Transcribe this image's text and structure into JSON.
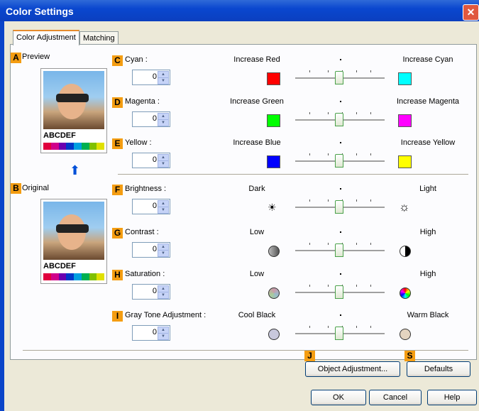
{
  "window": {
    "title": "Color Settings"
  },
  "tabs": [
    {
      "label": "Color Adjustment"
    },
    {
      "label": "Matching"
    }
  ],
  "preview": {
    "badge": "A",
    "label": "Preview",
    "caption": "ABCDEF"
  },
  "original": {
    "badge": "B",
    "label": "Original",
    "caption": "ABCDEF"
  },
  "rows": [
    {
      "badge": "C",
      "label": "Cyan :",
      "value": "0",
      "left": "Increase Red",
      "right": "Increase Cyan",
      "left_color": "#ff0000",
      "right_color": "#00ffff"
    },
    {
      "badge": "D",
      "label": "Magenta :",
      "value": "0",
      "left": "Increase Green",
      "right": "Increase Magenta",
      "left_color": "#00ff00",
      "right_color": "#ff00ff"
    },
    {
      "badge": "E",
      "label": "Yellow :",
      "value": "0",
      "left": "Increase Blue",
      "right": "Increase Yellow",
      "left_color": "#0000ff",
      "right_color": "#ffff00"
    },
    {
      "badge": "F",
      "label": "Brightness :",
      "value": "0",
      "left": "Dark",
      "right": "Light",
      "left_icon": "☀",
      "right_icon": "☼"
    },
    {
      "badge": "G",
      "label": "Contrast :",
      "value": "0",
      "left": "Low",
      "right": "High"
    },
    {
      "badge": "H",
      "label": "Saturation :",
      "value": "0",
      "left": "Low",
      "right": "High"
    },
    {
      "badge": "I",
      "label": "Gray Tone Adjustment :",
      "value": "0",
      "left": "Cool Black",
      "right": "Warm Black"
    }
  ],
  "buttons": {
    "object_badge": "J",
    "object_label": "Object Adjustment...",
    "defaults_badge": "S",
    "defaults_label": "Defaults",
    "ok": "OK",
    "cancel": "Cancel",
    "help": "Help"
  }
}
